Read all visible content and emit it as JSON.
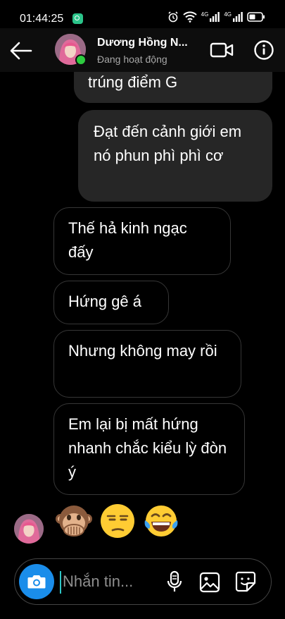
{
  "status_bar": {
    "time": "01:44:25",
    "network_label": "4G"
  },
  "header": {
    "contact_name": "Dương Hồng N...",
    "activity": "Đang hoạt động"
  },
  "messages": [
    {
      "side": "sent",
      "text": "trúng điểm G"
    },
    {
      "side": "sent",
      "text": "Đạt đến cảnh giới em nó phun phì phì cơ"
    },
    {
      "side": "received",
      "text": "Thế hả kinh ngạc đấy"
    },
    {
      "side": "received",
      "text": "Hứng gê á"
    },
    {
      "side": "received",
      "text": "Nhưng không may rồi"
    },
    {
      "side": "received",
      "text": "Em lại bị mất hứng nhanh chắc kiểu lỳ đòn ý"
    }
  ],
  "emojis": [
    "speak-no-evil-monkey",
    "unamused-face",
    "face-with-tears-of-joy"
  ],
  "composer": {
    "placeholder": "Nhắn tin..."
  },
  "colors": {
    "background": "#000000",
    "sent_bubble": "#262626",
    "camera_button": "#1a8dea",
    "online": "#2ecc40"
  }
}
